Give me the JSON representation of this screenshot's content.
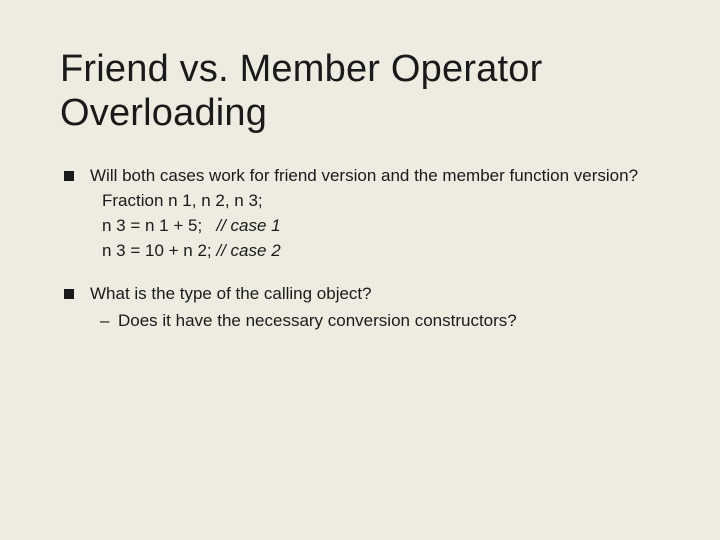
{
  "title": "Friend vs. Member Operator Overloading",
  "bullets": [
    {
      "text": "Will both cases work for friend version and the member function version?",
      "code": [
        {
          "stmt": "Fraction n 1, n 2, n 3;",
          "comment": ""
        },
        {
          "stmt": "n 3 = n 1 + 5;",
          "comment": "// case 1"
        },
        {
          "stmt": "n 3 = 10 + n 2;",
          "comment": "// case 2"
        }
      ]
    },
    {
      "text": "What is the type of the calling object?",
      "sub": [
        "Does it have the necessary conversion constructors?"
      ]
    }
  ]
}
